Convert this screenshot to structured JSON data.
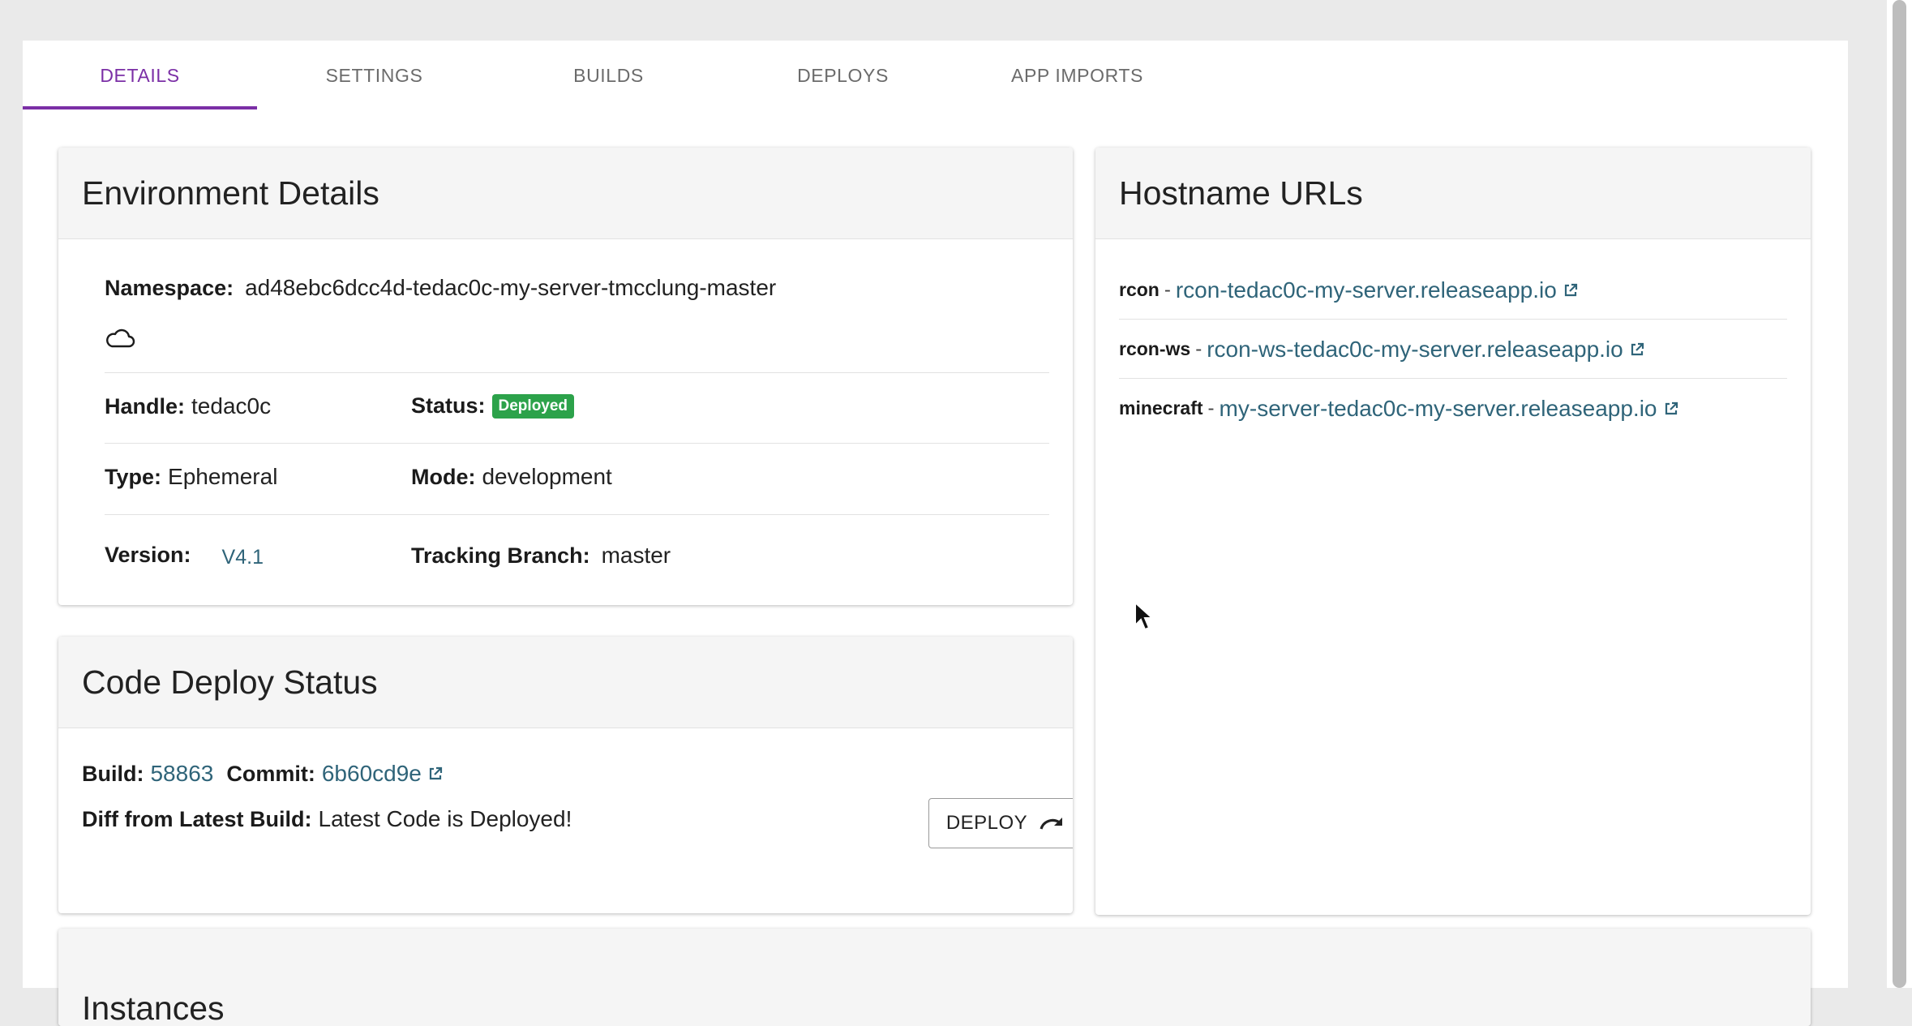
{
  "tabs": [
    {
      "label": "DETAILS",
      "active": true
    },
    {
      "label": "SETTINGS",
      "active": false
    },
    {
      "label": "BUILDS",
      "active": false
    },
    {
      "label": "DEPLOYS",
      "active": false
    },
    {
      "label": "APP IMPORTS",
      "active": false
    }
  ],
  "env_details": {
    "title": "Environment Details",
    "namespace_label": "Namespace:",
    "namespace_value": "ad48ebc6dcc4d-tedac0c-my-server-tmcclung-master",
    "handle_label": "Handle:",
    "handle_value": "tedac0c",
    "status_label": "Status:",
    "status_value": "Deployed",
    "type_label": "Type:",
    "type_value": "Ephemeral",
    "mode_label": "Mode:",
    "mode_value": "development",
    "version_label": "Version:",
    "version_value": "V4.1",
    "branch_label": "Tracking Branch:",
    "branch_value": "master"
  },
  "code_deploy": {
    "title": "Code Deploy Status",
    "build_label": "Build:",
    "build_value": "58863",
    "commit_label": "Commit:",
    "commit_value": "6b60cd9e",
    "diff_label": "Diff from Latest Build:",
    "diff_value": "Latest Code is Deployed!",
    "deploy_button": "DEPLOY"
  },
  "hostnames": {
    "title": "Hostname URLs",
    "items": [
      {
        "name": "rcon",
        "separator": "-",
        "url": "rcon-tedac0c-my-server.releaseapp.io"
      },
      {
        "name": "rcon-ws",
        "separator": "-",
        "url": "rcon-ws-tedac0c-my-server.releaseapp.io"
      },
      {
        "name": "minecraft",
        "separator": "-",
        "url": "my-server-tedac0c-my-server.releaseapp.io"
      }
    ]
  },
  "instances": {
    "title": "Instances"
  },
  "colors": {
    "accent": "#7b2fa6",
    "link": "#2f6479",
    "deployed_badge": "#2ca24a"
  }
}
